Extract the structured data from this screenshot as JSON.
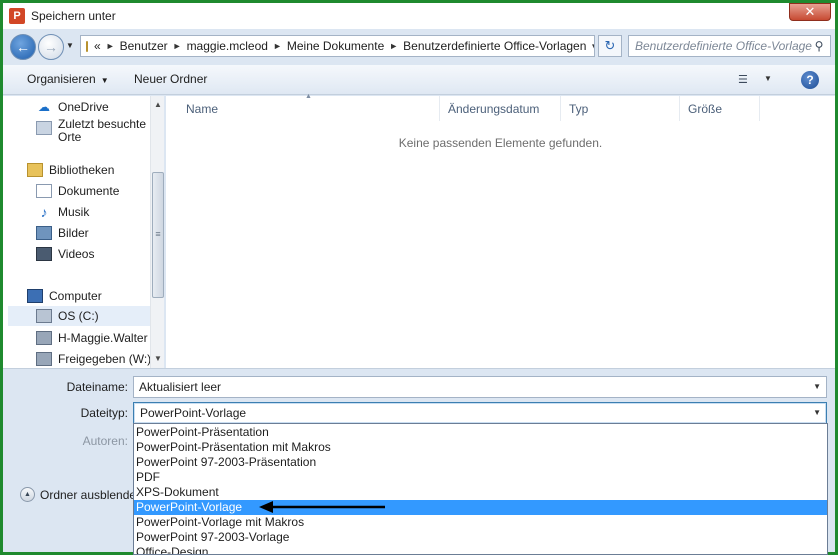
{
  "window": {
    "title": "Speichern unter",
    "app_icon_letter": "P",
    "close_label": "✕"
  },
  "address": {
    "overflow": "«",
    "breadcrumbs": [
      "Benutzer",
      "maggie.mcleod",
      "Meine Dokumente",
      "Benutzerdefinierte Office-Vorlagen"
    ],
    "search_placeholder": "Benutzerdefinierte Office-Vorlagen durchsuchen"
  },
  "toolbar": {
    "organize_label": "Organisieren",
    "new_folder_label": "Neuer Ordner"
  },
  "navigation": {
    "items": [
      {
        "label": "OneDrive",
        "icon": "cloud-icon"
      },
      {
        "label": "Zuletzt besuchte",
        "label2": "Orte",
        "icon": "recent-places-icon"
      },
      {
        "label": "Bibliotheken",
        "icon": "libraries-icon"
      },
      {
        "label": "Dokumente",
        "icon": "documents-icon"
      },
      {
        "label": "Musik",
        "icon": "music-icon"
      },
      {
        "label": "Bilder",
        "icon": "pictures-icon"
      },
      {
        "label": "Videos",
        "icon": "videos-icon"
      },
      {
        "label": "Computer",
        "icon": "computer-icon"
      },
      {
        "label": "OS (C:)",
        "icon": "drive-icon"
      },
      {
        "label": "H-Maggie.Walter",
        "icon": "network-drive-icon"
      },
      {
        "label": "Freigegeben (W:)",
        "icon": "network-drive-icon"
      }
    ]
  },
  "filelist": {
    "columns": [
      "Name",
      "Änderungsdatum",
      "Typ",
      "Größe"
    ],
    "empty_message": "Keine passenden Elemente gefunden."
  },
  "form": {
    "filename_label": "Dateiname:",
    "filename_value": "Aktualisiert leer",
    "filetype_label": "Dateityp:",
    "filetype_value": "PowerPoint-Vorlage",
    "authors_label": "Autoren:",
    "hide_folders_label": "Ordner ausblenden"
  },
  "filetype_options": [
    "PowerPoint-Präsentation",
    "PowerPoint-Präsentation mit Makros",
    "PowerPoint 97-2003-Präsentation",
    "PDF",
    "XPS-Dokument",
    "PowerPoint-Vorlage",
    "PowerPoint-Vorlage mit Makros",
    "PowerPoint 97-2003-Vorlage",
    "Office-Design"
  ],
  "selected_option_index": 5,
  "colors": {
    "frame_border": "#1f8a2e",
    "selection": "#3399ff",
    "dialog_bg": "#dce6f2"
  }
}
